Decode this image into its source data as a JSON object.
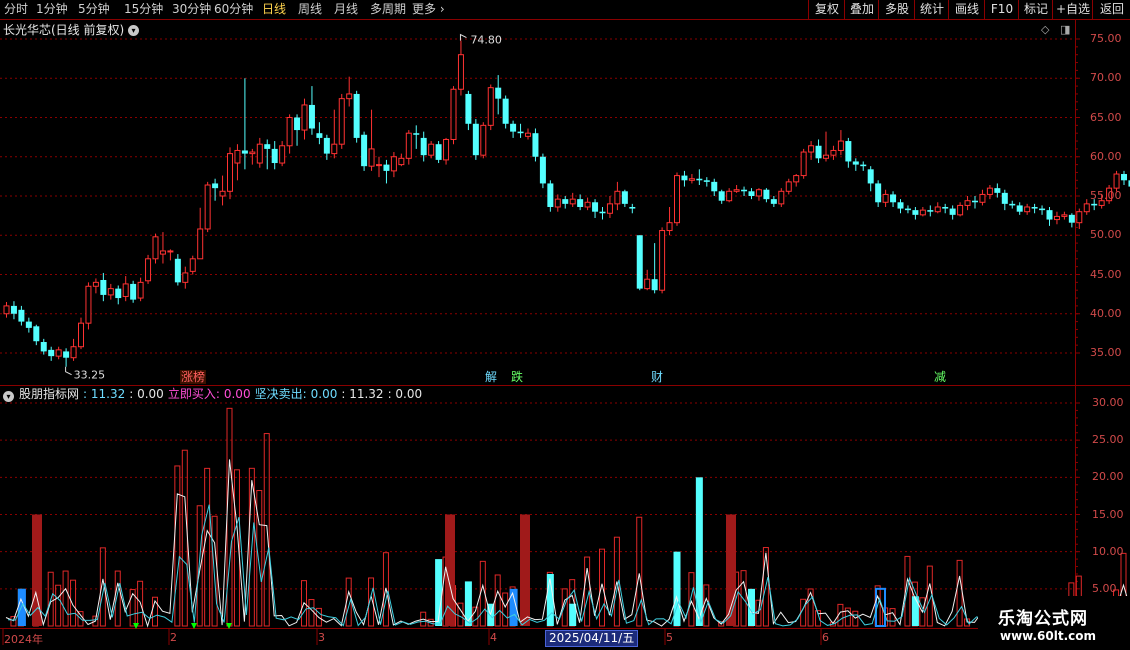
{
  "toolbar": {
    "periods": [
      "分时",
      "1分钟",
      "5分钟",
      "15分钟",
      "30分钟",
      "60分钟",
      "日线",
      "周线",
      "月线",
      "多周期",
      "更多"
    ],
    "active_period": "日线",
    "more_chevron": "›",
    "right_buttons": [
      "复权",
      "叠加",
      "多股",
      "统计",
      "画线",
      "F10",
      "标记",
      "+自选",
      "返回"
    ]
  },
  "main_panel": {
    "title": "长光华芯(日线 前复权)",
    "price_axis": [
      "75.00",
      "70.00",
      "65.00",
      "60.00",
      "55.00",
      "50.00",
      "45.00",
      "40.00",
      "35.00"
    ],
    "high_marker": "74.80",
    "low_marker": "33.25",
    "events": [
      {
        "label": "涨榜",
        "color": "#ff5f5f",
        "bg": "#3a1000"
      },
      {
        "label": "解",
        "color": "#6fdcff",
        "bg": ""
      },
      {
        "label": "跌",
        "color": "#66ff66",
        "bg": ""
      },
      {
        "label": "财",
        "color": "#6fdcff",
        "bg": ""
      },
      {
        "label": "减",
        "color": "#66ff66",
        "bg": ""
      }
    ]
  },
  "indicator_panel": {
    "name": "股朋指标网",
    "value1": ": 11.32",
    "value2": ": 0.00",
    "buy_label": "立即买入:",
    "buy_value": "0.00",
    "sell_label": "坚决卖出:",
    "sell_value": "0.00",
    "value3": ": 11.32",
    "value4": ": 0.00",
    "axis": [
      "30.00",
      "25.00",
      "20.00",
      "15.00",
      "10.00",
      "5.00"
    ]
  },
  "time_axis": {
    "labels": [
      "2024年",
      "2",
      "3",
      "4",
      "5",
      "6"
    ],
    "cursor_date": "2025/04/11/五"
  },
  "watermark": {
    "title": "乐淘公式网",
    "url": "www.60lt.com"
  },
  "colors": {
    "up": "#ff3232",
    "down": "#54ffff",
    "grid": "#8a0000",
    "buy": "#00ff00",
    "sell_bar": "#a01a1a",
    "signal_blue": "#1e8cff"
  },
  "chart_data": {
    "type": "candlestick",
    "y_range": [
      32,
      76
    ],
    "candles": [
      [
        40,
        41,
        39.5,
        41.5
      ],
      [
        41,
        40,
        39.3,
        41.6
      ],
      [
        40.5,
        39,
        38.5,
        41
      ],
      [
        39,
        38.2,
        37.6,
        39.5
      ],
      [
        38.4,
        36.5,
        36,
        38.6
      ],
      [
        36.4,
        35.2,
        34.8,
        36.8
      ],
      [
        35.4,
        34.6,
        34,
        35.8
      ],
      [
        34.6,
        35.4,
        34.2,
        35.8
      ],
      [
        35.2,
        34.4,
        33.25,
        35.6
      ],
      [
        34.4,
        35.8,
        34,
        36.8
      ],
      [
        35.8,
        38.8,
        35.5,
        39.5
      ],
      [
        38.8,
        43.5,
        38,
        44
      ],
      [
        43.5,
        44,
        42.6,
        44.5
      ],
      [
        44.3,
        42.4,
        41.6,
        45.2
      ],
      [
        42.4,
        43.2,
        41.8,
        43.8
      ],
      [
        43.2,
        42,
        41.2,
        43.6
      ],
      [
        42.2,
        43.8,
        41.6,
        44.8
      ],
      [
        43.8,
        41.8,
        41.4,
        44.2
      ],
      [
        42,
        44,
        41.6,
        44.6
      ],
      [
        44.2,
        47,
        43.8,
        47.5
      ],
      [
        47,
        49.8,
        46.4,
        50.2
      ],
      [
        47.6,
        48,
        46.4,
        50.4
      ],
      [
        48,
        48,
        46.8,
        48.2
      ],
      [
        47,
        44,
        43.6,
        47.6
      ],
      [
        44,
        45.2,
        43.2,
        46
      ],
      [
        45.4,
        47,
        45,
        47.4
      ],
      [
        47,
        50.8,
        47,
        53.5
      ],
      [
        50.8,
        56.4,
        50.4,
        56.8
      ],
      [
        56.6,
        56,
        54.4,
        57.2
      ],
      [
        55,
        55.6,
        53.8,
        57.6
      ],
      [
        55.6,
        60.4,
        54.6,
        61.2
      ],
      [
        59.2,
        60.8,
        57,
        61.6
      ],
      [
        60.8,
        60.4,
        58.4,
        70
      ],
      [
        60.4,
        60.6,
        59,
        61
      ],
      [
        59.2,
        61.6,
        58.6,
        62.4
      ],
      [
        61.6,
        61,
        58.4,
        62.2
      ],
      [
        61,
        59.2,
        58.4,
        62
      ],
      [
        59.2,
        61.4,
        58.8,
        62
      ],
      [
        61.4,
        65,
        60.4,
        65.4
      ],
      [
        65,
        63.4,
        61.4,
        65.4
      ],
      [
        63.4,
        66.6,
        62.2,
        67.4
      ],
      [
        66.6,
        63.6,
        62.8,
        69
      ],
      [
        63,
        62.4,
        61.6,
        64.4
      ],
      [
        62.4,
        60.4,
        59.6,
        62.8
      ],
      [
        60.4,
        61.6,
        59.8,
        66
      ],
      [
        61.6,
        67.4,
        61,
        68
      ],
      [
        67.4,
        68,
        66.4,
        70.2
      ],
      [
        68,
        62.4,
        61.8,
        68.4
      ],
      [
        62.8,
        58.8,
        58.2,
        63.2
      ],
      [
        58.8,
        61,
        58.2,
        66
      ],
      [
        59,
        59,
        57.4,
        60
      ],
      [
        59,
        58.2,
        56.6,
        59.6
      ],
      [
        58.2,
        60,
        57.4,
        60.6
      ],
      [
        59,
        59.8,
        58.8,
        60.4
      ],
      [
        59.8,
        63,
        59,
        63.4
      ],
      [
        63,
        62.8,
        61,
        64
      ],
      [
        62.4,
        60.2,
        59.4,
        63.2
      ],
      [
        60.2,
        61.6,
        59.8,
        62
      ],
      [
        61.6,
        59.6,
        59.2,
        62
      ],
      [
        59.6,
        62.2,
        59,
        62.4
      ],
      [
        62.2,
        68.6,
        61.6,
        69
      ],
      [
        68.6,
        73,
        67.8,
        74.8
      ],
      [
        68,
        64.2,
        63.4,
        68.4
      ],
      [
        64.2,
        60.2,
        59.6,
        64.8
      ],
      [
        60.2,
        64,
        59.8,
        64.4
      ],
      [
        64,
        68.8,
        63.4,
        69.2
      ],
      [
        68.8,
        67.4,
        65.4,
        70.4
      ],
      [
        67.4,
        64.2,
        63.6,
        67.8
      ],
      [
        64.2,
        63.2,
        62.4,
        64.6
      ],
      [
        63.2,
        63,
        62.4,
        64.2
      ],
      [
        62.6,
        63,
        62.2,
        63.6
      ],
      [
        63,
        60,
        59.4,
        63.6
      ],
      [
        60,
        56.6,
        56,
        60.4
      ],
      [
        56.6,
        53.6,
        53,
        57
      ],
      [
        53.6,
        54.6,
        53,
        55.2
      ],
      [
        54.6,
        54,
        53.4,
        55
      ],
      [
        54,
        54.6,
        53.6,
        55.4
      ],
      [
        54.6,
        53.6,
        53.2,
        55.2
      ],
      [
        53.6,
        54.2,
        53.2,
        54.8
      ],
      [
        54.2,
        53,
        52.2,
        54.6
      ],
      [
        53,
        52.8,
        52,
        53.6
      ],
      [
        52.8,
        54,
        52.2,
        55
      ],
      [
        54,
        55.6,
        53.2,
        56.8
      ],
      [
        55.6,
        54,
        53.6,
        55.8
      ],
      [
        53.6,
        53.4,
        52.8,
        54
      ],
      [
        50,
        43.2,
        43,
        50
      ],
      [
        43.2,
        44.4,
        43,
        45.6
      ],
      [
        44.4,
        43,
        42.6,
        49
      ],
      [
        43,
        50.6,
        42.6,
        51
      ],
      [
        50.6,
        51.6,
        50,
        53.6
      ],
      [
        51.6,
        57.6,
        51.2,
        58
      ],
      [
        57.6,
        57,
        56.2,
        58.2
      ],
      [
        57,
        57.2,
        56.6,
        57.8
      ],
      [
        57.2,
        57,
        56.4,
        58.4
      ],
      [
        57,
        56.8,
        56.2,
        57.4
      ],
      [
        56.8,
        55.6,
        55,
        57.2
      ],
      [
        55.6,
        54.4,
        54,
        55.8
      ],
      [
        54.4,
        55.6,
        54.2,
        56
      ],
      [
        55.6,
        55.8,
        55.4,
        56.4
      ],
      [
        55.8,
        55.6,
        55,
        56.2
      ],
      [
        55.6,
        55,
        54.6,
        56
      ],
      [
        55,
        55.8,
        54.4,
        56
      ],
      [
        55.8,
        54.6,
        54.2,
        56
      ],
      [
        54.6,
        54,
        53.6,
        55
      ],
      [
        54,
        55.6,
        53.6,
        56
      ],
      [
        55.6,
        56.8,
        55.2,
        57.2
      ],
      [
        56.8,
        57.6,
        56.2,
        57.8
      ],
      [
        57.6,
        60.6,
        57.2,
        61
      ],
      [
        60.6,
        61.4,
        59.6,
        62
      ],
      [
        61.4,
        59.8,
        59.2,
        62.2
      ],
      [
        59.8,
        60.2,
        59.4,
        63.2
      ],
      [
        60.2,
        60.8,
        59.6,
        61.4
      ],
      [
        60.8,
        62,
        60.2,
        63.4
      ],
      [
        62,
        59.4,
        58.6,
        62.4
      ],
      [
        59.4,
        59,
        58.2,
        59.8
      ],
      [
        59,
        58.8,
        58.2,
        59.4
      ],
      [
        58.4,
        56.6,
        55.6,
        58.8
      ],
      [
        56.6,
        54.2,
        53.6,
        57
      ],
      [
        54.2,
        55.2,
        53.6,
        55.8
      ],
      [
        55.2,
        54.2,
        53.6,
        55.6
      ],
      [
        54.2,
        53.4,
        52.8,
        54.6
      ],
      [
        53.4,
        53.2,
        52.8,
        53.8
      ],
      [
        53.2,
        52.6,
        52,
        53.6
      ],
      [
        52.6,
        53.2,
        52.4,
        53.6
      ],
      [
        53.2,
        53,
        52.4,
        53.8
      ],
      [
        53,
        53.6,
        52.8,
        54.2
      ],
      [
        53.6,
        53.4,
        52.8,
        54
      ],
      [
        53.4,
        52.6,
        52,
        53.8
      ],
      [
        52.6,
        53.8,
        52.4,
        54.2
      ],
      [
        53.8,
        54.4,
        53.2,
        55
      ],
      [
        54.4,
        54.2,
        53.4,
        55
      ],
      [
        54.2,
        55.2,
        53.8,
        55.8
      ],
      [
        55.2,
        56,
        54.6,
        56.4
      ],
      [
        56,
        55.4,
        54.8,
        56.6
      ],
      [
        55.4,
        54,
        53.2,
        55.8
      ],
      [
        54,
        53.8,
        53.4,
        54.4
      ],
      [
        53.8,
        53,
        52.6,
        54.2
      ],
      [
        53,
        53.6,
        52.6,
        54
      ],
      [
        53.6,
        53.4,
        52.8,
        54
      ],
      [
        53.4,
        53.2,
        52.6,
        53.8
      ],
      [
        53.2,
        52,
        51.2,
        53.6
      ],
      [
        52,
        52.4,
        51.4,
        53
      ],
      [
        52.4,
        52.6,
        52,
        53
      ],
      [
        52.6,
        51.6,
        51,
        52.8
      ],
      [
        51.6,
        53,
        50.8,
        53.4
      ],
      [
        53,
        54,
        52.6,
        54.6
      ],
      [
        54,
        53.8,
        53.2,
        54.6
      ],
      [
        53.8,
        54.4,
        53.4,
        55.2
      ],
      [
        54.4,
        56,
        54,
        56.4
      ],
      [
        56,
        57.8,
        55.6,
        58.2
      ],
      [
        57.8,
        57,
        56.4,
        58.2
      ],
      [
        57,
        56.2,
        55.4,
        57.4
      ],
      [
        56.2,
        55.4,
        54.8,
        56.6
      ],
      [
        55.4,
        55.8,
        55.2,
        56.2
      ],
      [
        55.8,
        54,
        53.4,
        56.2
      ],
      [
        54,
        53.6,
        53,
        54.4
      ],
      [
        53.6,
        57.6,
        53.2,
        58
      ],
      [
        57.6,
        59.6,
        57.2,
        61
      ],
      [
        59.6,
        60.4,
        58,
        61.8
      ]
    ],
    "indicator": {
      "sell_bars": [
        {
          "pos": 37,
          "value": 15
        },
        {
          "pos": 450,
          "value": 15
        },
        {
          "pos": 525,
          "value": 15
        },
        {
          "pos": 731,
          "value": 15
        }
      ],
      "buy_markers": [
        136,
        194,
        229
      ]
    }
  }
}
